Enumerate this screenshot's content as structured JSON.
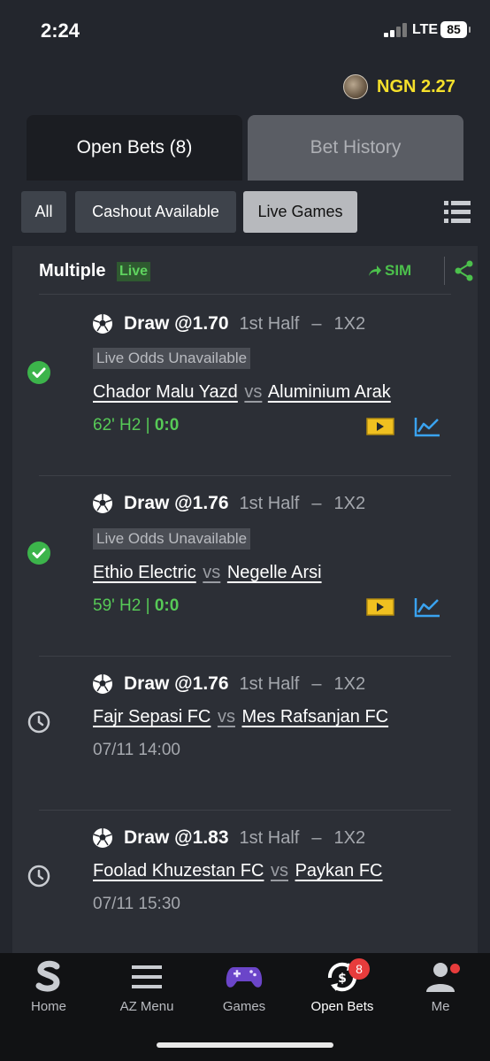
{
  "status_bar": {
    "time": "2:24",
    "network": "LTE",
    "battery": "85"
  },
  "account": {
    "balance": "NGN 2.27"
  },
  "tabs": [
    {
      "label": "Open Bets (8)",
      "active": true
    },
    {
      "label": "Bet History",
      "active": false
    }
  ],
  "filters": [
    {
      "label": "All",
      "selected": false
    },
    {
      "label": "Cashout Available",
      "selected": false
    },
    {
      "label": "Live Games",
      "selected": true
    }
  ],
  "bet_card": {
    "type": "Multiple",
    "live_label": "Live",
    "sim_label": "SIM",
    "selections": [
      {
        "pick": "Draw @1.70",
        "period": "1st Half",
        "market": "1X2",
        "note": "Live Odds Unavailable",
        "home": "Chador Malu Yazd",
        "vs": "vs",
        "away": "Aluminium Arak",
        "live_time": "62' H2 | ",
        "score": "0:0",
        "status": "won"
      },
      {
        "pick": "Draw @1.76",
        "period": "1st Half",
        "market": "1X2",
        "note": "Live Odds Unavailable",
        "home": "Ethio Electric",
        "vs": "vs",
        "away": "Negelle Arsi",
        "live_time": "59' H2 | ",
        "score": "0:0",
        "status": "won"
      },
      {
        "pick": "Draw @1.76",
        "period": "1st Half",
        "market": "1X2",
        "home": "Fajr Sepasi FC",
        "vs": "vs",
        "away": "Mes Rafsanjan FC",
        "kickoff": "07/11 14:00",
        "status": "pending"
      },
      {
        "pick": "Draw @1.83",
        "period": "1st Half",
        "market": "1X2",
        "home": "Foolad Khuzestan FC",
        "vs": "vs",
        "away": "Paykan FC",
        "kickoff": "07/11 15:30",
        "status": "pending"
      }
    ]
  },
  "tabbar": [
    {
      "label": "Home",
      "icon": "sportybet-logo-icon"
    },
    {
      "label": "AZ Menu",
      "icon": "menu-icon"
    },
    {
      "label": "Games",
      "icon": "gamepad-icon"
    },
    {
      "label": "Open Bets",
      "icon": "open-bets-icon",
      "badge": "8",
      "active": true
    },
    {
      "label": "Me",
      "icon": "user-icon"
    }
  ],
  "colors": {
    "live_green": "#57c957",
    "balance_yellow": "#f5e02b",
    "badge_red": "#e73c3c",
    "accent_blue": "#3aa3f0"
  }
}
